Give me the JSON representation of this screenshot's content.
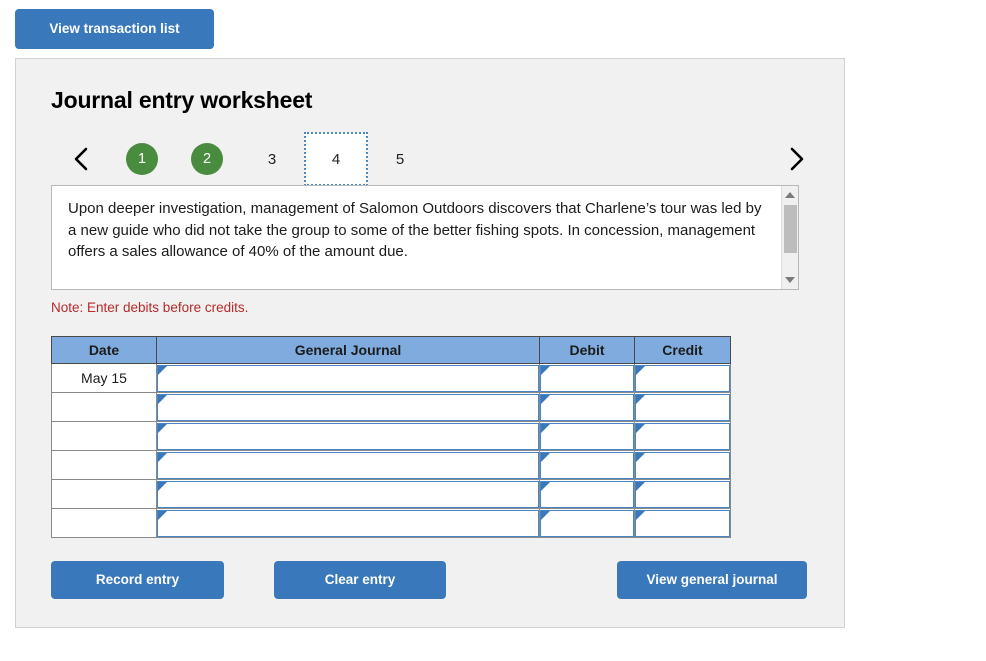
{
  "top": {
    "view_transaction_list_label": "View transaction list"
  },
  "panel": {
    "title": "Journal entry worksheet",
    "stepper": {
      "prev_icon": "chevron-left-icon",
      "next_icon": "chevron-right-icon",
      "steps": [
        {
          "label": "1",
          "state": "done"
        },
        {
          "label": "2",
          "state": "done"
        },
        {
          "label": "3",
          "state": "inactive"
        },
        {
          "label": "4",
          "state": "current"
        },
        {
          "label": "5",
          "state": "inactive"
        }
      ]
    },
    "description": "Upon deeper investigation, management of Salomon Outdoors discovers that Charlene’s tour was led by a new guide who did not take the group to some of the better fishing spots. In concession, management offers a sales allowance of 40% of the amount due.",
    "note": "Note: Enter debits before credits.",
    "table": {
      "headers": [
        "Date",
        "General Journal",
        "Debit",
        "Credit"
      ],
      "rows": [
        {
          "date": "May 15",
          "general_journal": "",
          "debit": "",
          "credit": ""
        },
        {
          "date": "",
          "general_journal": "",
          "debit": "",
          "credit": ""
        },
        {
          "date": "",
          "general_journal": "",
          "debit": "",
          "credit": ""
        },
        {
          "date": "",
          "general_journal": "",
          "debit": "",
          "credit": ""
        },
        {
          "date": "",
          "general_journal": "",
          "debit": "",
          "credit": ""
        },
        {
          "date": "",
          "general_journal": "",
          "debit": "",
          "credit": ""
        }
      ]
    },
    "buttons": {
      "record_entry": "Record entry",
      "clear_entry": "Clear entry",
      "view_general_journal": "View general journal"
    }
  },
  "colors": {
    "button_blue": "#3a78bc",
    "header_blue": "#7fabde",
    "step_green": "#4a8c3f",
    "note_red": "#b52a2a",
    "panel_gray": "#f1f1f1",
    "cell_border_blue": "#4a86c5"
  }
}
